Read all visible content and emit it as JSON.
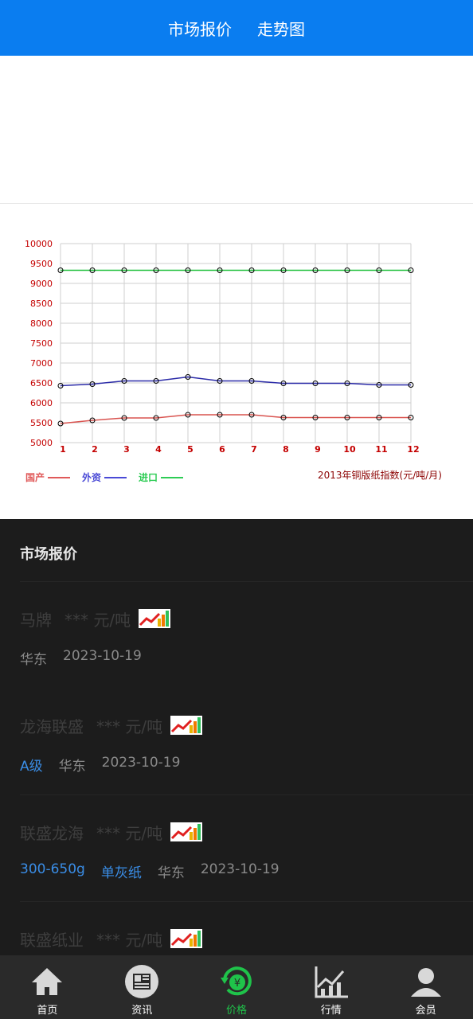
{
  "header": {
    "tabs": [
      "市场报价",
      "走势图"
    ]
  },
  "chart_data": {
    "type": "line",
    "title": "2013年铜版纸指数(元/吨/月)",
    "categories": [
      "1",
      "2",
      "3",
      "4",
      "5",
      "6",
      "7",
      "8",
      "9",
      "10",
      "11",
      "12"
    ],
    "ylim": [
      5000,
      10000
    ],
    "yticks": [
      "5000",
      "5500",
      "6000",
      "6500",
      "7000",
      "7500",
      "8000",
      "8500",
      "9000",
      "9500",
      "10000"
    ],
    "grid": true,
    "legend_position": "bottom-left",
    "series": [
      {
        "name": "国产",
        "color": "#d9534f",
        "legend_color": "#e05a5a",
        "values": [
          5480,
          5560,
          5620,
          5620,
          5700,
          5700,
          5700,
          5630,
          5630,
          5630,
          5630,
          5630
        ]
      },
      {
        "name": "外资",
        "color": "#2b2ba8",
        "legend_color": "#4a4ad6",
        "values": [
          6430,
          6470,
          6550,
          6550,
          6650,
          6550,
          6550,
          6490,
          6490,
          6490,
          6450,
          6450
        ]
      },
      {
        "name": "进口",
        "color": "#1fbf3a",
        "legend_color": "#2ecc55",
        "values": [
          9330,
          9330,
          9330,
          9330,
          9330,
          9330,
          9330,
          9330,
          9330,
          9330,
          9330,
          9330
        ]
      }
    ]
  },
  "market": {
    "title": "市场报价",
    "items": [
      {
        "name": "马牌",
        "price": "*** 元/吨",
        "tags": [],
        "region": "华东",
        "date": "2023-10-19"
      },
      {
        "name": "龙海联盛",
        "price": "*** 元/吨",
        "tags": [
          "A级"
        ],
        "region": "华东",
        "date": "2023-10-19"
      },
      {
        "name": "联盛龙海",
        "price": "*** 元/吨",
        "tags": [
          "300-650g",
          "单灰纸"
        ],
        "region": "华东",
        "date": "2023-10-19"
      },
      {
        "name": "联盛纸业",
        "price": "*** 元/吨",
        "tags": [],
        "region": "",
        "date": ""
      }
    ]
  },
  "nav": {
    "items": [
      {
        "label": "首页",
        "icon": "home-icon"
      },
      {
        "label": "资讯",
        "icon": "news-icon"
      },
      {
        "label": "价格",
        "icon": "price-icon",
        "active": true
      },
      {
        "label": "行情",
        "icon": "market-trend-icon"
      },
      {
        "label": "会员",
        "icon": "member-icon"
      }
    ]
  },
  "colors": {
    "header": "#0a7df0",
    "active": "#1fc34a",
    "link": "#3a8de6"
  }
}
